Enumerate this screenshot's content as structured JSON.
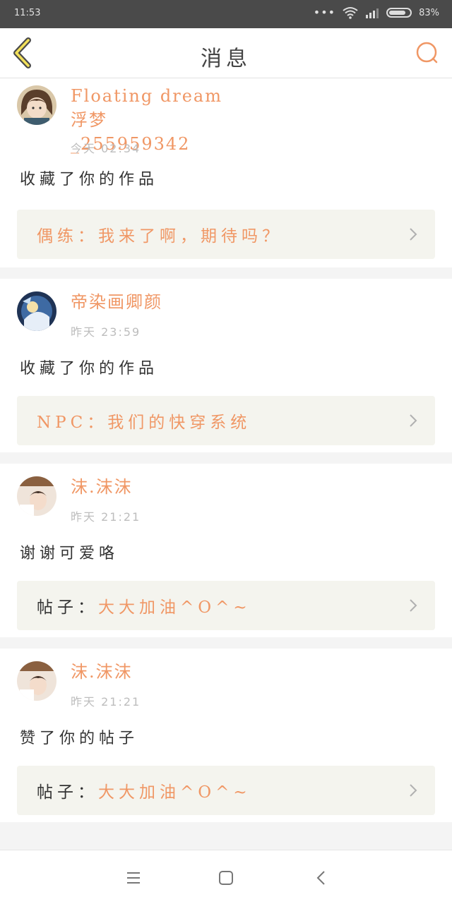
{
  "status_bar": {
    "time": "11:53",
    "battery": "83%",
    "battery_level": 0.83
  },
  "header": {
    "title": "消息"
  },
  "colors": {
    "accent": "#f09765",
    "ref_bg": "#f4f4ee",
    "title": "#444444",
    "muted": "#bdbdbd"
  },
  "messages": [
    {
      "user": "Floating dream 浮梦_255959342",
      "time": "今天 02:34",
      "action": "收藏了你的作品",
      "ref_prefix": "",
      "ref_text": "偶练：我来了啊，期待吗？",
      "avatar": "avatar-girl-brown-hair"
    },
    {
      "user": "帝染画卿颜",
      "time": "昨天 23:59",
      "action": "收藏了你的作品",
      "ref_prefix": "",
      "ref_text": "NPC：我们的快穿系统",
      "avatar": "avatar-blue-anime"
    },
    {
      "user": "沫.沫沫",
      "time": "昨天 21:21",
      "action": "谢谢可爱咯",
      "ref_prefix": "帖子：",
      "ref_text": "大大加油^O^~",
      "avatar": "avatar-boy"
    },
    {
      "user": "沫.沫沫",
      "time": "昨天 21:21",
      "action": "赞了你的帖子",
      "ref_prefix": "帖子：",
      "ref_text": "大大加油^O^~",
      "avatar": "avatar-boy"
    }
  ],
  "nav": {
    "icons": [
      "menu-icon",
      "home-square-icon",
      "back-triangle-icon"
    ]
  }
}
